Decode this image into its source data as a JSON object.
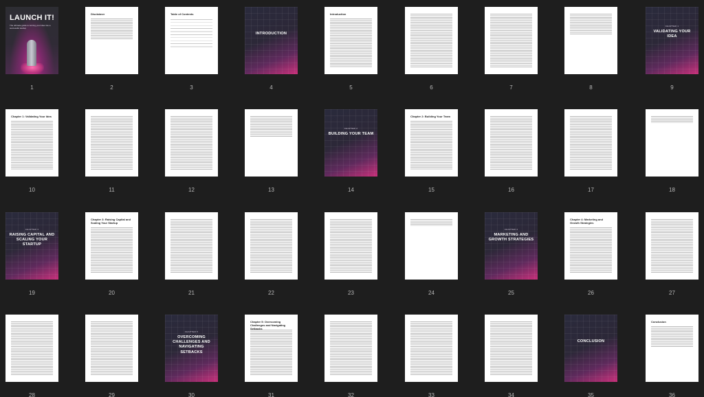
{
  "pages": [
    {
      "num": "1",
      "style": "cover",
      "title": "LAUNCH IT!",
      "subtitle": "The ultimate guide to turning your idea into a successful startup"
    },
    {
      "num": "2",
      "style": "text",
      "heading": "Disclaimer",
      "lines": "short"
    },
    {
      "num": "3",
      "style": "toc",
      "heading": "Table of Contents"
    },
    {
      "num": "4",
      "style": "section",
      "title": "INTRODUCTION",
      "eyebrow": ""
    },
    {
      "num": "5",
      "style": "text",
      "heading": "Introduction",
      "lines": "full"
    },
    {
      "num": "6",
      "style": "text",
      "heading": "",
      "lines": "full"
    },
    {
      "num": "7",
      "style": "text",
      "heading": "",
      "lines": "full"
    },
    {
      "num": "8",
      "style": "text",
      "heading": "",
      "lines": "short"
    },
    {
      "num": "9",
      "style": "section",
      "title": "VALIDATING YOUR IDEA",
      "eyebrow": "CHAPTER 1"
    },
    {
      "num": "10",
      "style": "text",
      "heading": "Chapter 1: Validating Your Idea",
      "lines": "full"
    },
    {
      "num": "11",
      "style": "text",
      "heading": "",
      "lines": "full"
    },
    {
      "num": "12",
      "style": "text",
      "heading": "",
      "lines": "full"
    },
    {
      "num": "13",
      "style": "text",
      "heading": "",
      "lines": "short"
    },
    {
      "num": "14",
      "style": "section",
      "title": "BUILDING YOUR TEAM",
      "eyebrow": "CHAPTER 2"
    },
    {
      "num": "15",
      "style": "text",
      "heading": "Chapter 2: Building Your Team",
      "lines": "full"
    },
    {
      "num": "16",
      "style": "text",
      "heading": "",
      "lines": "full"
    },
    {
      "num": "17",
      "style": "text",
      "heading": "",
      "lines": "full"
    },
    {
      "num": "18",
      "style": "text",
      "heading": "",
      "lines": "tiny"
    },
    {
      "num": "19",
      "style": "section",
      "title": "RAISING CAPITAL AND SCALING YOUR STARTUP",
      "eyebrow": "CHAPTER 3"
    },
    {
      "num": "20",
      "style": "text",
      "heading": "Chapter 3: Raising Capital and Scaling Your Startup",
      "lines": "full"
    },
    {
      "num": "21",
      "style": "text",
      "heading": "",
      "lines": "full"
    },
    {
      "num": "22",
      "style": "text",
      "heading": "",
      "lines": "full"
    },
    {
      "num": "23",
      "style": "text",
      "heading": "",
      "lines": "full"
    },
    {
      "num": "24",
      "style": "text",
      "heading": "",
      "lines": "tiny"
    },
    {
      "num": "25",
      "style": "section",
      "title": "MARKETING AND GROWTH STRATEGIES",
      "eyebrow": "CHAPTER 4"
    },
    {
      "num": "26",
      "style": "text",
      "heading": "Chapter 4: Marketing and Growth Strategies",
      "lines": "full"
    },
    {
      "num": "27",
      "style": "text",
      "heading": "",
      "lines": "full"
    },
    {
      "num": "28",
      "style": "text",
      "heading": "",
      "lines": "full"
    },
    {
      "num": "29",
      "style": "text",
      "heading": "",
      "lines": "full"
    },
    {
      "num": "30",
      "style": "section",
      "title": "OVERCOMING CHALLENGES AND NAVIGATING SETBACKS",
      "eyebrow": "CHAPTER 5"
    },
    {
      "num": "31",
      "style": "text",
      "heading": "Chapter 5: Overcoming Challenges and Navigating Setbacks",
      "lines": "full"
    },
    {
      "num": "32",
      "style": "text",
      "heading": "",
      "lines": "full"
    },
    {
      "num": "33",
      "style": "text",
      "heading": "",
      "lines": "full"
    },
    {
      "num": "34",
      "style": "text",
      "heading": "",
      "lines": "full"
    },
    {
      "num": "35",
      "style": "section",
      "title": "CONCLUSION",
      "eyebrow": ""
    },
    {
      "num": "36",
      "style": "text",
      "heading": "Conclusion",
      "lines": "short"
    }
  ],
  "colors": {
    "background": "#1e1e1e",
    "accent": "#c8307a",
    "page_number": "#b9b9b9"
  }
}
